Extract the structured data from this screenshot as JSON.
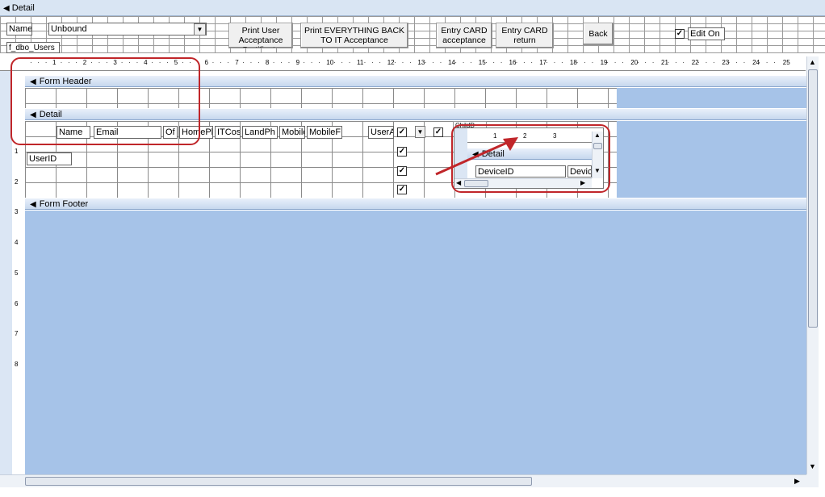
{
  "window": {
    "title": "Detail"
  },
  "toolbar": {
    "name_label": "Name",
    "name_value": "Unbound",
    "form_name_label": "f_dbo_Users",
    "buttons": {
      "print_user": "Print User Acceptance Certificate",
      "print_everything": "Print EVERYTHING BACK TO IT Acceptance",
      "entry_card_acceptance": "Entry CARD acceptance",
      "entry_card_return": "Entry CARD return",
      "back": "Back"
    },
    "edit_on_label": "Edit On",
    "edit_on_checked": true
  },
  "ruler": {
    "ticks": [
      "1",
      "2",
      "3",
      "4",
      "5",
      "6",
      "7",
      "8",
      "9",
      "10",
      "11",
      "12",
      "13",
      "14",
      "15",
      "16",
      "17",
      "18",
      "19",
      "20",
      "21",
      "22",
      "23",
      "24",
      "25"
    ],
    "v_ticks": [
      "1",
      "2",
      "3",
      "4",
      "5",
      "6",
      "7",
      "8"
    ]
  },
  "sections": {
    "form_header": "Form Header",
    "detail": "Detail",
    "form_footer": "Form Footer"
  },
  "detail_fields": {
    "name": "Name",
    "email": "Email",
    "of": "Of",
    "home_ph": "HomePh",
    "it_cos": "ITCos",
    "land_ph": "LandPh",
    "mobile": "Mobile",
    "mobile_f": "MobileF",
    "user_a": "UserA",
    "user_id": "UserID",
    "child": "ChildD"
  },
  "subform": {
    "ruler_ticks": [
      "1",
      "2",
      "3"
    ],
    "section": "Detail",
    "field_device_id": "DeviceID",
    "field_devic": "Devic"
  },
  "colors": {
    "design_blue": "#a6c3e8",
    "annotation_red": "#c0262a"
  }
}
